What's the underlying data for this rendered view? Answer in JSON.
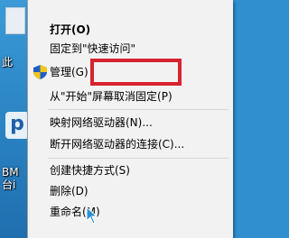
{
  "desktop": {
    "icon_label_1": "此",
    "icon_label_2": "BM",
    "icon_label_3": "台i",
    "icon_letter": "p"
  },
  "menu": {
    "items": [
      {
        "label": "打开(O)",
        "bold": true
      },
      {
        "label": "固定到\"快速访问\""
      },
      {
        "label": "管理(G)",
        "icon": "shield-icon"
      },
      {
        "label": "从\"开始\"屏幕取消固定(P)"
      },
      {
        "label": "映射网络驱动器(N)..."
      },
      {
        "label": "断开网络驱动器的连接(C)..."
      },
      {
        "label": "创建快捷方式(S)"
      },
      {
        "label": "删除(D)"
      },
      {
        "label": "重命名(M)"
      }
    ]
  },
  "colors": {
    "highlight_border": "#d5232f",
    "menu_bg": "#f2f2f2",
    "desktop_bg": "#2f8fcf"
  }
}
